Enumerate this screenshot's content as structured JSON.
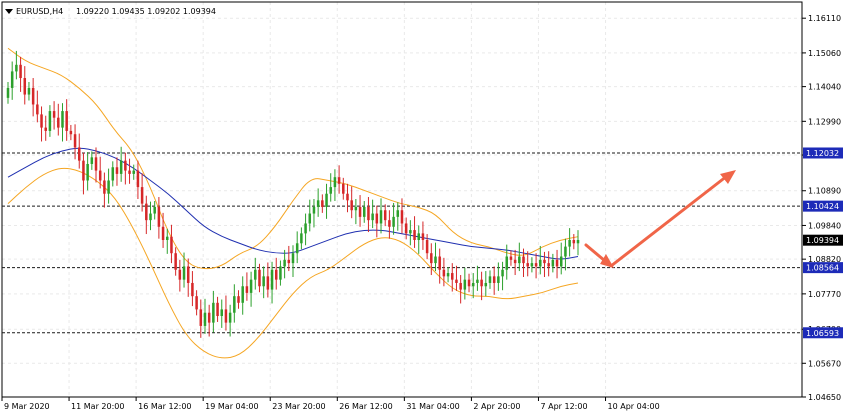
{
  "header": {
    "symbol_timeframe": "EURUSD,H4",
    "ohlc": "1.09220 1.09435 1.09202 1.09394"
  },
  "colors": {
    "background": "#ffffff",
    "grid": "#e9e9e9",
    "frame": "#000000",
    "bull_candle": "#2ca02c",
    "bear_candle": "#d62728",
    "bollinger": "#f5a623",
    "moving_average": "#1f2fb0",
    "level_line": "#1a1a1a",
    "current_price_box": "#000000",
    "level_box": "#1d2bb8",
    "arrow": "#f06548"
  },
  "chart_data": {
    "type": "candlestick",
    "symbol": "EURUSD",
    "timeframe": "H4",
    "ylim": [
      1.0465,
      1.166
    ],
    "grid": true,
    "y_ticks": [
      "1.16110",
      "1.15060",
      "1.14040",
      "1.12990",
      "1.11970",
      "1.10890",
      "1.09840",
      "1.08820",
      "1.07770",
      "1.06700",
      "1.05670",
      "1.04650"
    ],
    "y_tick_values": [
      1.1611,
      1.1506,
      1.1404,
      1.1299,
      1.1197,
      1.1089,
      1.0984,
      1.0882,
      1.0777,
      1.067,
      1.0567,
      1.0465
    ],
    "x_ticks": [
      "9 Mar 2020",
      "11 Mar 20:00",
      "16 Mar 12:00",
      "19 Mar 04:00",
      "23 Mar 20:00",
      "26 Mar 12:00",
      "31 Mar 04:00",
      "2 Apr 20:00",
      "7 Apr 12:00",
      "10 Apr 04:00"
    ],
    "x_tick_index": [
      0,
      16,
      32,
      48,
      64,
      80,
      96,
      112,
      128,
      144
    ],
    "current_price": {
      "value": 1.09394,
      "label": "1.09394"
    },
    "levels": [
      {
        "value": 1.12032,
        "label": "1.12032"
      },
      {
        "value": 1.10424,
        "label": "1.10424"
      },
      {
        "value": 1.08564,
        "label": "1.08564"
      },
      {
        "value": 1.06593,
        "label": "1.06593"
      }
    ],
    "series": [
      {
        "type": "close",
        "values": [
          1.14,
          1.145,
          1.147,
          1.143,
          1.138,
          1.14,
          1.135,
          1.132,
          1.128,
          1.127,
          1.133,
          1.131,
          1.128,
          1.133,
          1.127,
          1.126,
          1.122,
          1.118,
          1.112,
          1.117,
          1.119,
          1.115,
          1.112,
          1.108,
          1.112,
          1.116,
          1.114,
          1.118,
          1.115,
          1.114,
          1.115,
          1.11,
          1.105,
          1.1,
          1.102,
          1.104,
          1.098,
          1.094,
          1.095,
          1.09,
          1.085,
          1.082,
          1.086,
          1.081,
          1.077,
          1.073,
          1.068,
          1.072,
          1.069,
          1.075,
          1.071,
          1.073,
          1.069,
          1.072,
          1.077,
          1.075,
          1.08,
          1.078,
          1.082,
          1.085,
          1.08,
          1.083,
          1.079,
          1.085,
          1.082,
          1.086,
          1.088,
          1.087,
          1.09,
          1.093,
          1.096,
          1.099,
          1.102,
          1.104,
          1.106,
          1.104,
          1.108,
          1.11,
          1.113,
          1.111,
          1.108,
          1.106,
          1.103,
          1.104,
          1.101,
          1.104,
          1.1,
          1.102,
          1.099,
          1.103,
          1.1,
          1.098,
          1.101,
          1.103,
          1.099,
          1.096,
          1.097,
          1.094,
          1.096,
          1.094,
          1.09,
          1.087,
          1.089,
          1.085,
          1.083,
          1.084,
          1.082,
          1.081,
          1.079,
          1.082,
          1.08,
          1.081,
          1.082,
          1.08,
          1.081,
          1.083,
          1.081,
          1.083,
          1.085,
          1.089,
          1.088,
          1.087,
          1.089,
          1.087,
          1.086,
          1.087,
          1.086,
          1.088,
          1.087,
          1.086,
          1.088,
          1.086,
          1.089,
          1.092,
          1.094,
          1.093,
          1.094
        ]
      },
      {
        "type": "moving_average",
        "values": [
          1.113,
          1.116,
          1.119,
          1.121,
          1.122,
          1.121,
          1.119,
          1.116,
          1.112,
          1.108,
          1.103,
          1.098,
          1.095,
          1.093,
          1.091,
          1.09,
          1.09,
          1.092,
          1.094,
          1.096,
          1.097,
          1.097,
          1.096,
          1.095,
          1.094,
          1.093,
          1.092,
          1.0915,
          1.091,
          1.09,
          1.089,
          1.088,
          1.089
        ]
      },
      {
        "type": "bollinger_upper",
        "values": [
          1.152,
          1.148,
          1.146,
          1.144,
          1.14,
          1.135,
          1.127,
          1.121,
          1.11,
          1.096,
          1.087,
          1.085,
          1.086,
          1.09,
          1.092,
          1.098,
          1.106,
          1.113,
          1.112,
          1.111,
          1.109,
          1.107,
          1.105,
          1.104,
          1.102,
          1.096,
          1.093,
          1.092,
          1.09,
          1.089,
          1.092,
          1.094,
          1.095
        ]
      },
      {
        "type": "bollinger_lower",
        "values": [
          1.105,
          1.11,
          1.114,
          1.116,
          1.115,
          1.112,
          1.107,
          1.098,
          1.087,
          1.075,
          1.065,
          1.06,
          1.058,
          1.059,
          1.064,
          1.071,
          1.078,
          1.083,
          1.085,
          1.089,
          1.093,
          1.095,
          1.094,
          1.09,
          1.084,
          1.079,
          1.077,
          1.077,
          1.076,
          1.077,
          1.078,
          1.08,
          1.081
        ]
      }
    ]
  }
}
